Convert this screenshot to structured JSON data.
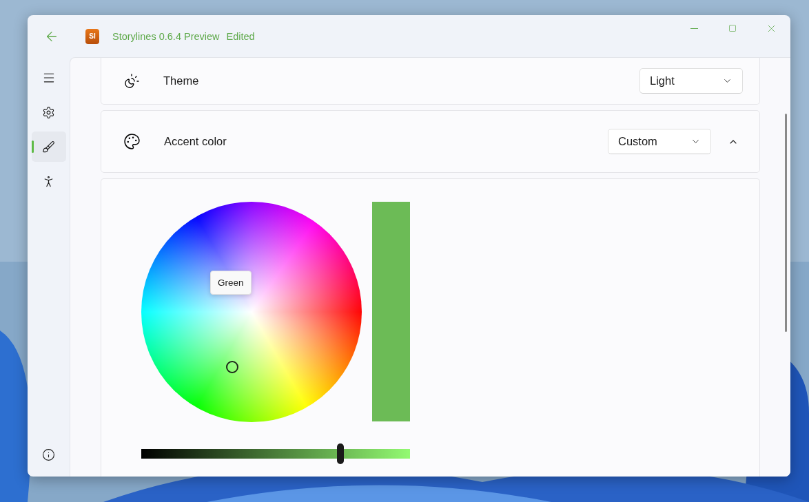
{
  "window": {
    "app_icon_text": "SI",
    "title": "Storylines 0.6.4 Preview",
    "status": "Edited"
  },
  "nav": {
    "items": [
      {
        "kind": "settings",
        "selected": false
      },
      {
        "kind": "brush",
        "selected": true
      },
      {
        "kind": "accessibility",
        "selected": false
      }
    ]
  },
  "settings": [
    {
      "kind": "theme",
      "label": "Theme",
      "value": "Light"
    },
    {
      "kind": "palette",
      "label": "Accent color",
      "value": "Custom",
      "expanded": true
    }
  ],
  "color_picker": {
    "tooltip": "Green",
    "color": "#6cbb56",
    "brightness": {
      "level": 0.74
    }
  }
}
